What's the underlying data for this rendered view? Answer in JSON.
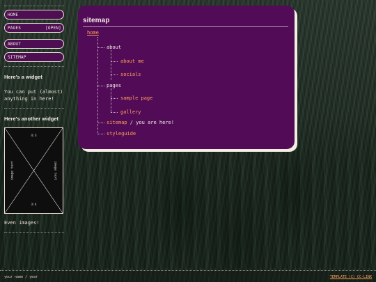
{
  "nav": {
    "items": [
      {
        "label": "HOME"
      },
      {
        "label": "PAGES",
        "tag": "[OPEN]"
      },
      {
        "label": "ABOUT"
      },
      {
        "label": "SITEMAP"
      }
    ]
  },
  "sidebar": {
    "widget1_title": "Here's a widget",
    "widget1_text": "You can put (almost) anything in here!",
    "widget2_title": "Here's another widget",
    "image": {
      "top": "4:3",
      "bottom": "3:4",
      "left": "image text",
      "right": "image text"
    },
    "widget2_caption": "Even images!"
  },
  "main": {
    "title": "sitemap",
    "tree": {
      "home": "home",
      "about": "about",
      "about_me": "about me",
      "socials": "socials",
      "pages": "pages",
      "sample_page": "sample page",
      "gallery": "gallery",
      "sitemap": "sitemap",
      "you_are_here": "/ you are here!",
      "styleguide": "styleguide"
    }
  },
  "footer": {
    "left": "your name / year",
    "right": "TEMPLATE (C) CC-LINK"
  },
  "colors": {
    "panel": "#520c57",
    "link": "#ff9e5a",
    "cream": "#f4eee2"
  }
}
